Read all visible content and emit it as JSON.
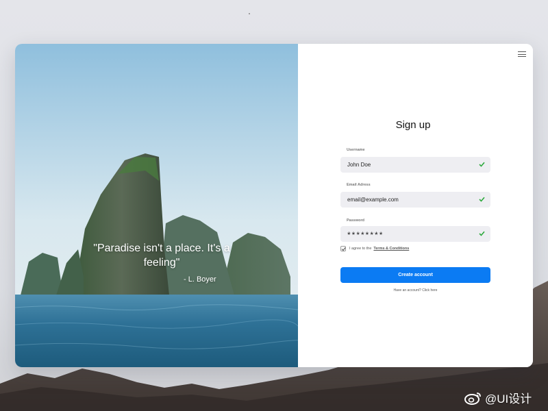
{
  "hero": {
    "quote": "\"Paradise isn't a place. It's a feeling\"",
    "author": "- L. Boyer"
  },
  "form": {
    "title": "Sign up",
    "username": {
      "label": "Username",
      "value": "John Doe"
    },
    "email": {
      "label": "Email Adress",
      "value": "email@example.com"
    },
    "password": {
      "label": "Password",
      "value": "********"
    },
    "agree_text": "I agree to the",
    "terms_link": "Terms & Conditions",
    "submit_label": "Create account",
    "login_link": "Have an account? Click here"
  },
  "watermark": {
    "text": "@UI设计"
  },
  "icons": {
    "menu": "hamburger-icon",
    "valid": "check-icon",
    "checkbox": "checkbox-checked",
    "watermark": "weibo-icon"
  },
  "colors": {
    "primary": "#0b7bf3",
    "valid": "#2faa3f",
    "field_bg": "#eeeef2"
  }
}
